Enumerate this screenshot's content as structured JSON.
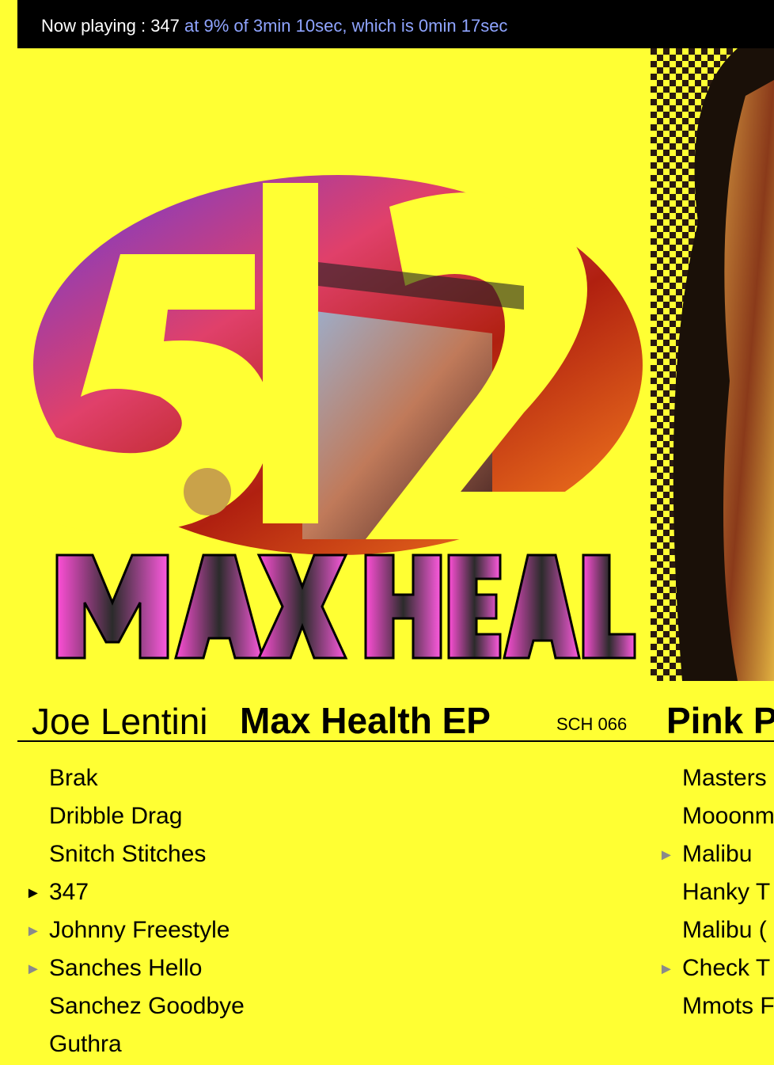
{
  "now_playing": {
    "label": "Now playing : ",
    "track": "347",
    "progress_text": " at 9% of 3min 10sec, which is 0min 17sec",
    "progress_percent": 9,
    "accent_color": "#8fa4ff"
  },
  "albums": [
    {
      "artist": "Joe Lentini",
      "title": "Max Health EP",
      "catalog": "SCH 066",
      "cover_text_top": "512",
      "cover_text_bottom": "MAX HEALTH",
      "tracks": [
        {
          "name": "Brak",
          "play": ""
        },
        {
          "name": "Dribble Drag",
          "play": ""
        },
        {
          "name": "Snitch Stitches",
          "play": ""
        },
        {
          "name": "347",
          "play": "active"
        },
        {
          "name": "Johnny Freestyle",
          "play": "inactive"
        },
        {
          "name": "Sanches Hello",
          "play": "inactive"
        },
        {
          "name": "Sanchez Goodbye",
          "play": ""
        },
        {
          "name": "Guthra",
          "play": ""
        }
      ]
    },
    {
      "title": "Pink P",
      "tracks": [
        {
          "name": "Masters",
          "play": ""
        },
        {
          "name": "Mooonm",
          "play": ""
        },
        {
          "name": "Malibu",
          "play": "inactive"
        },
        {
          "name": "Hanky T",
          "play": ""
        },
        {
          "name": "Malibu (",
          "play": ""
        },
        {
          "name": "Check T",
          "play": "inactive"
        },
        {
          "name": "Mmots F",
          "play": ""
        }
      ]
    }
  ],
  "colors": {
    "background": "#ffff33",
    "bar": "#000000"
  },
  "icons": {
    "play": "play-triangle-icon"
  }
}
